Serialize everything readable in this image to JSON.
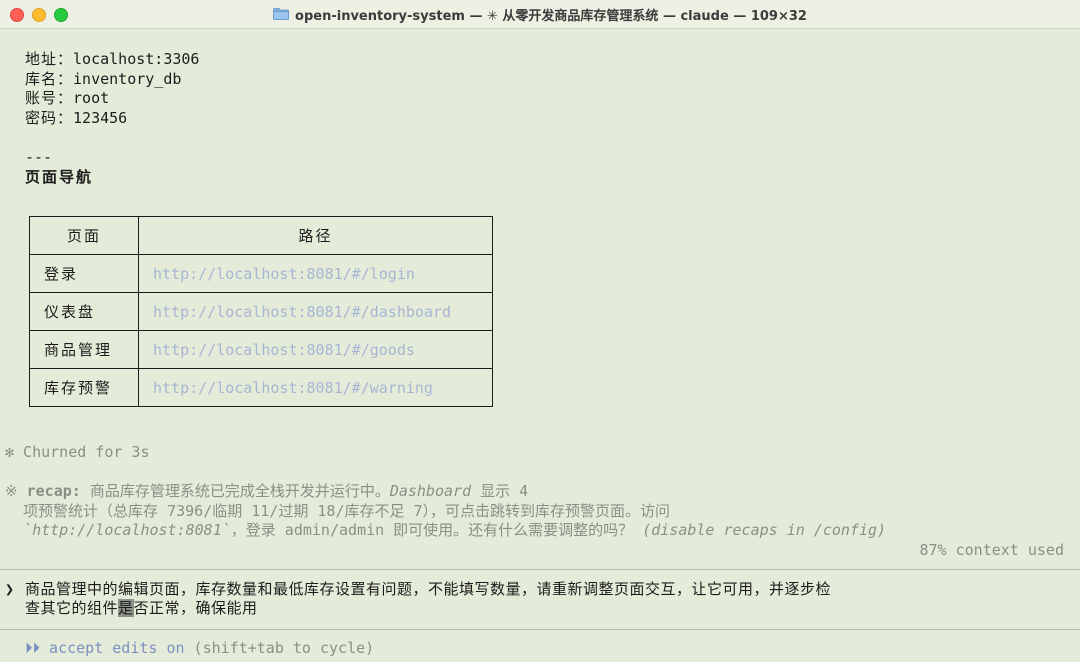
{
  "window": {
    "folder_icon": "folder-icon",
    "title": "open-inventory-system — ✳ 从零开发商品库存管理系统 — claude — 109×32"
  },
  "db": {
    "address_label": "地址：",
    "address_value": "localhost:3306",
    "dbname_label": "库名：",
    "dbname_value": "inventory_db",
    "account_label": "账号：",
    "account_value": "root",
    "password_label": "密码：",
    "password_value": "123456"
  },
  "separator": "---",
  "nav_heading": "页面导航",
  "nav_table": {
    "headers": [
      "页面",
      "路径"
    ],
    "rows": [
      {
        "page": "登录",
        "path": "http://localhost:8081/#/login"
      },
      {
        "page": "仪表盘",
        "path": "http://localhost:8081/#/dashboard"
      },
      {
        "page": "商品管理",
        "path": "http://localhost:8081/#/goods"
      },
      {
        "page": "库存预警",
        "path": "http://localhost:8081/#/warning"
      }
    ]
  },
  "churned": "✻ Churned for 3s",
  "recap": {
    "star": "※",
    "label": "recap:",
    "line1_a": " 商品库存管理系统已完成全栈开发并运行中。",
    "line1_b": "Dashboard",
    "line1_c": " 显示 4",
    "line2": "  项预警统计（总库存 7396/临期 11/过期 18/库存不足 7），可点击跳转到库存预警页面。访问",
    "line3_a": "  `http://localhost:8081`",
    "line3_b": "，登录 admin/admin 即可使用。还有什么需要调整的吗？",
    "line3_c": " (disable recaps in /config)"
  },
  "context_used": "87% context used",
  "prompt": {
    "marker": "❯",
    "line1": "商品管理中的编辑页面，库存数量和最低库存设置有问题，不能填写数量，请重新调整页面交互，让它可用，并逐步检",
    "line2_a": "查其它的组件",
    "line2_cursor": "是",
    "line2_b": "否正常，确保能用"
  },
  "mode": {
    "icon": "⏵⏵",
    "label": "accept edits on",
    "hint": "(shift+tab to cycle)"
  }
}
